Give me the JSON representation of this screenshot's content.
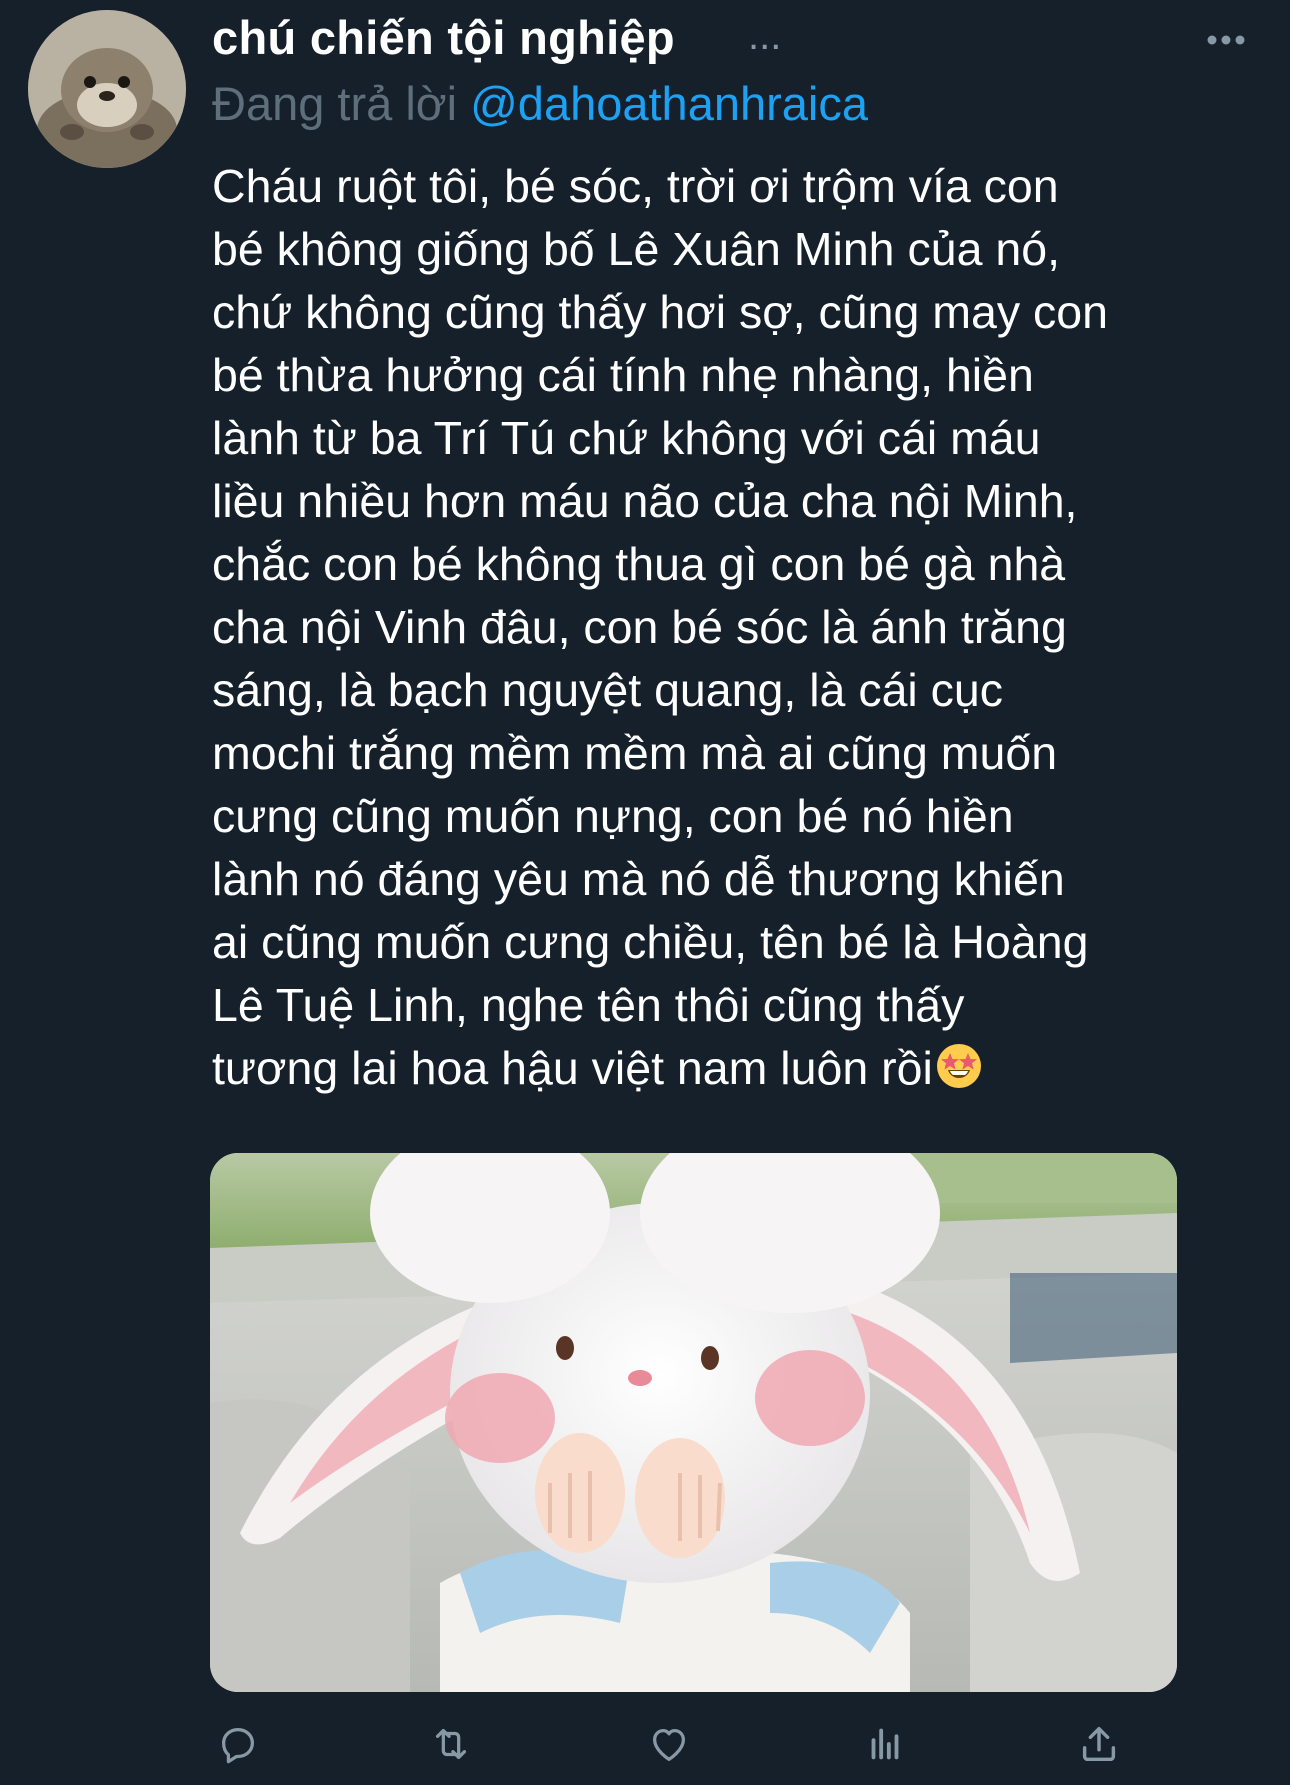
{
  "tweet": {
    "display_name": "chú chiến tội nghiệp",
    "name_ellipsis": "...",
    "reply_prefix": "Đang trả lời",
    "reply_handle": "@dahoathanhraica",
    "text": "Cháu ruột tôi, bé sóc, trời ơi trộm vía con\nbé không giống bố Lê Xuân Minh của nó,\nchứ không cũng thấy hơi sợ, cũng may con\nbé thừa hưởng cái tính nhẹ nhàng, hiền\nlành từ ba Trí Tú chứ không với cái máu\nliều nhiều hơn máu não của cha nội Minh,\nchắc con bé không thua gì con bé gà nhà\ncha nội Vinh đâu, con bé sóc là ánh trăng\nsáng, là bạch nguyệt quang, là cái cục\nmochi trắng mềm mềm mà ai cũng muốn\ncưng cũng muốn nựng, con bé nó hiền\nlành nó đáng yêu mà nó dễ thương khiến\nai cũng muốn cưng chiều, tên bé là Hoàng\nLê Tuệ Linh, nghe tên thôi cũng thấy\ntương lai hoa hậu việt nam luôn rồi",
    "emoji": "star-struck-emoji",
    "media": "photo-child-with-bunny-plush"
  },
  "actions": [
    "reply-icon",
    "retweet-icon",
    "like-icon",
    "analytics-icon",
    "share-icon"
  ],
  "colors": {
    "background": "#15202b",
    "text": "#ffffff",
    "secondary": "#8899a6",
    "link": "#1da1f2"
  }
}
